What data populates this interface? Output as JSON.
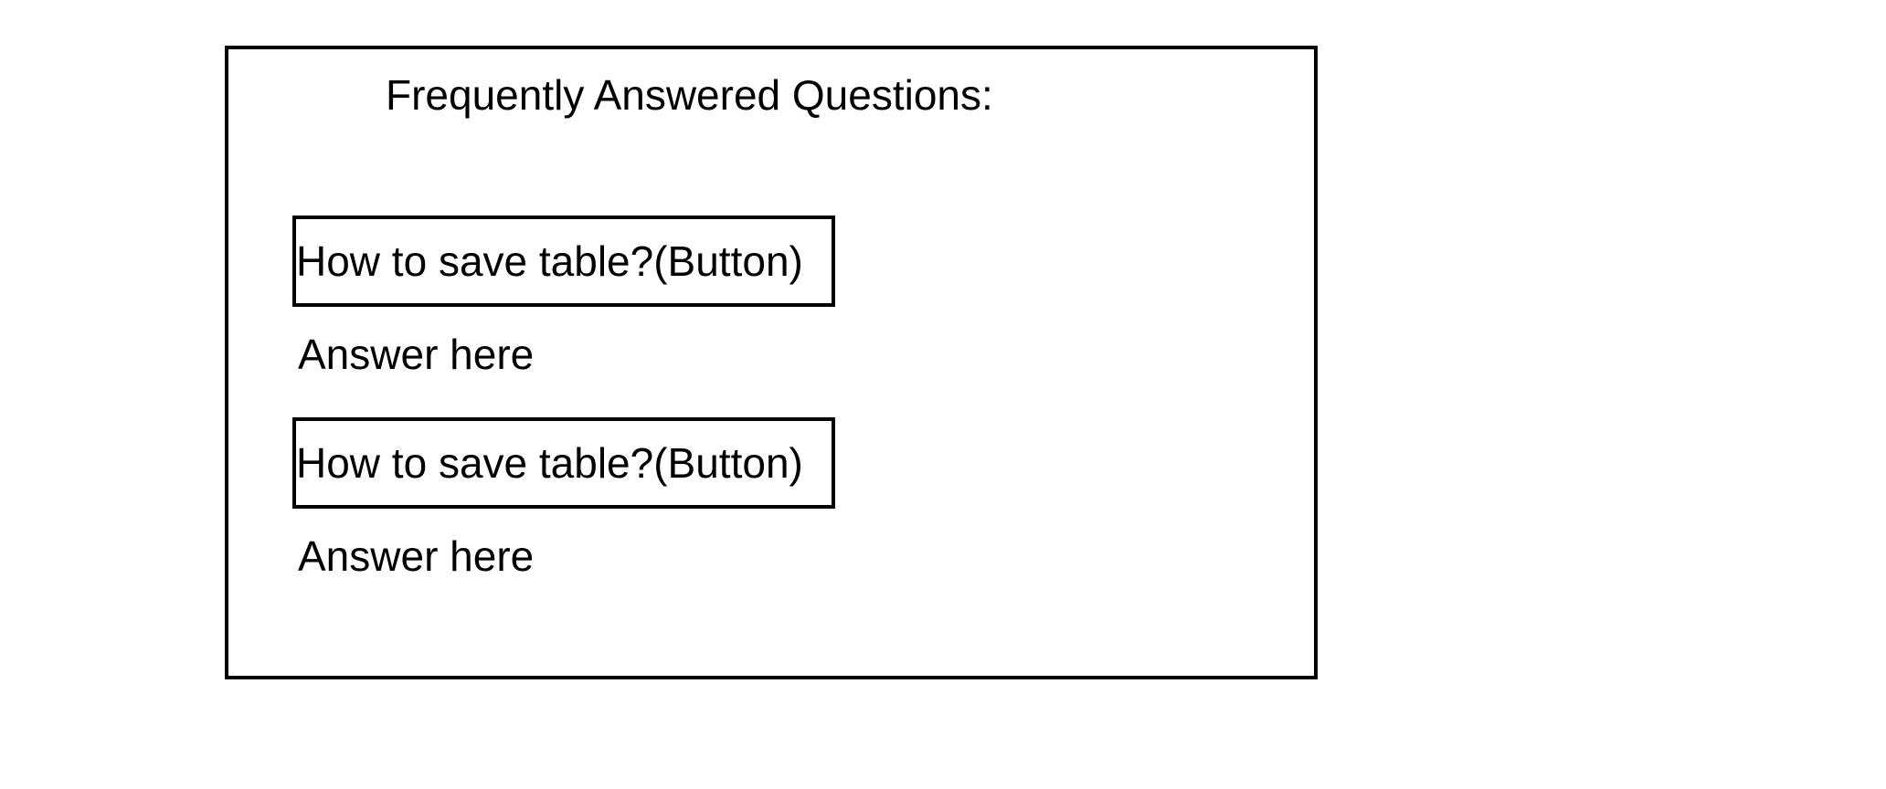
{
  "faq": {
    "title": "Frequently Answered Questions:",
    "items": [
      {
        "question": "How to save table?(Button)",
        "answer": "Answer here"
      },
      {
        "question": "How to save table?(Button)",
        "answer": "Answer here"
      }
    ]
  }
}
